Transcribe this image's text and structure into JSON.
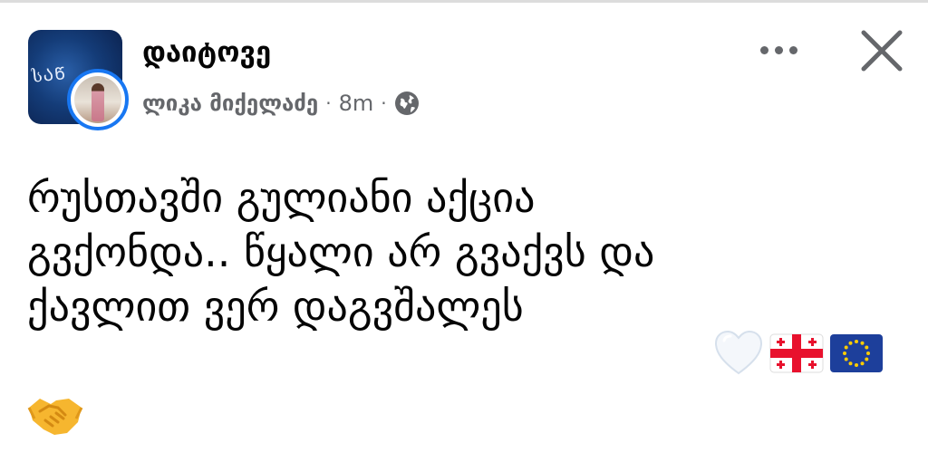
{
  "post": {
    "group_name": "დაიტოვე",
    "author_name": "ლიკა მიქელაძე",
    "time_ago": "8m",
    "separator": "·",
    "audience_icon": "globe-icon",
    "body_text": "რუსთავში გულიანი აქცია\nგვქონდა.. წყალი არ გვაქვს და\nქავლით ვერ დაგვშალეს",
    "emojis": [
      "white-heart-icon",
      "georgia-flag-icon",
      "eu-flag-icon",
      "handshake-icon"
    ]
  },
  "header": {
    "more_icon": "more-options-icon",
    "close_icon": "close-icon",
    "group_avatar_text": "სᲐᲬ"
  },
  "colors": {
    "accent": "#1877f2",
    "text_primary": "#050505",
    "text_secondary": "#65676b"
  }
}
